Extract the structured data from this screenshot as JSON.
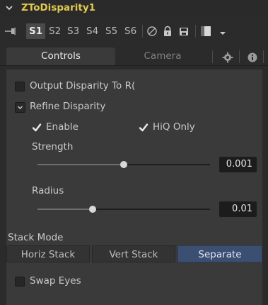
{
  "tool": {
    "title": "ZToDisparity1"
  },
  "toolbar": {
    "sets": [
      {
        "label": "S1",
        "active": true
      },
      {
        "label": "S2",
        "active": false
      },
      {
        "label": "S3",
        "active": false
      },
      {
        "label": "S4",
        "active": false
      },
      {
        "label": "S5",
        "active": false
      },
      {
        "label": "S6",
        "active": false
      }
    ],
    "icons": [
      "pin-icon",
      "disable-icon",
      "lock-icon",
      "save-icon",
      "color-swatch-icon",
      "dropdown-arrow-icon"
    ]
  },
  "tabs": [
    {
      "label": "Controls",
      "active": true
    },
    {
      "label": "Camera",
      "active": false
    }
  ],
  "tab_icons": [
    "gear-icon",
    "info-icon"
  ],
  "controls": {
    "output_disparity": {
      "label": "Output Disparity To R(",
      "checked": false
    },
    "refine_disparity": {
      "label": "Refine Disparity",
      "expanded": true
    },
    "enable": {
      "label": "Enable",
      "checked": true
    },
    "hiq_only": {
      "label": "HiQ Only",
      "checked": true
    },
    "strength": {
      "label": "Strength",
      "value": "0.001",
      "fraction": 0.5
    },
    "radius": {
      "label": "Radius",
      "value": "0.01",
      "fraction": 0.32
    },
    "stack_mode": {
      "label": "Stack Mode",
      "options": [
        {
          "label": "Horiz Stack",
          "selected": false
        },
        {
          "label": "Vert Stack",
          "selected": false
        },
        {
          "label": "Separate",
          "selected": true
        }
      ]
    },
    "swap_eyes": {
      "label": "Swap Eyes",
      "checked": false
    }
  },
  "colors": {
    "title": "#e3c84f",
    "panel_bg": "#2b2b2b",
    "content_bg": "#3a3a3a",
    "selected_button": "#3b4f73"
  }
}
